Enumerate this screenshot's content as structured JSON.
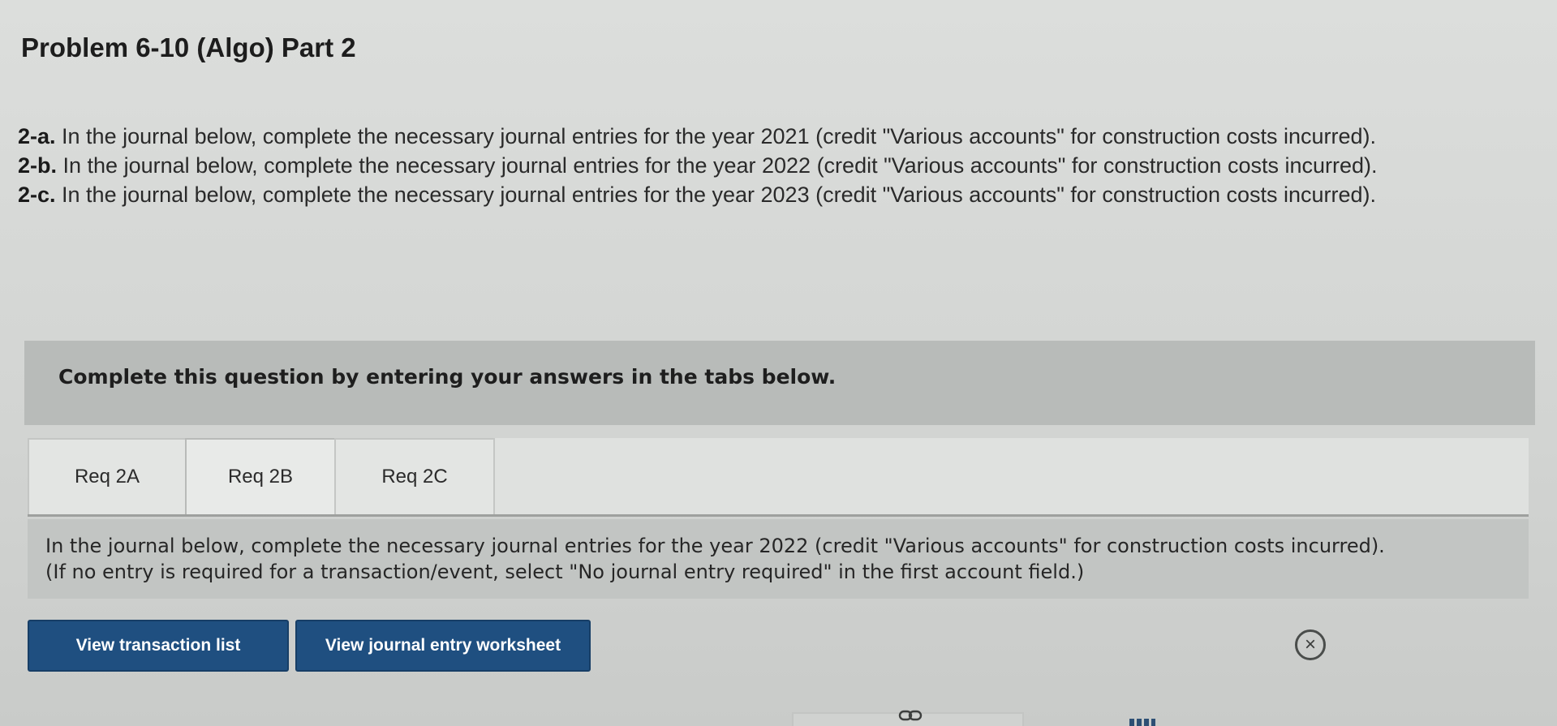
{
  "problem": {
    "title": "Problem 6-10 (Algo) Part 2"
  },
  "instructions": [
    {
      "label": "2-a.",
      "text": " In the journal below, complete the necessary journal entries for the year 2021 (credit \"Various accounts\" for construction costs incurred)."
    },
    {
      "label": "2-b.",
      "text": " In the journal below, complete the necessary journal entries for the year 2022 (credit \"Various accounts\" for construction costs incurred)."
    },
    {
      "label": "2-c.",
      "text": " In the journal below, complete the necessary journal entries for the year 2023 (credit \"Various accounts\" for construction costs incurred)."
    }
  ],
  "banner": {
    "text": "Complete this question by entering your answers in the tabs below."
  },
  "tabs": [
    {
      "label": "Req 2A",
      "active": false
    },
    {
      "label": "Req 2B",
      "active": true
    },
    {
      "label": "Req 2C",
      "active": false
    }
  ],
  "tab_content": {
    "line1": "In the journal below, complete the necessary journal entries for the year 2022 (credit \"Various accounts\" for construction costs incurred).",
    "line2": "(If no entry is required for a transaction/event, select \"No journal entry required\" in the first account field.)"
  },
  "buttons": {
    "view_transaction_list": "View transaction list",
    "view_journal_entry_worksheet": "View journal entry worksheet"
  },
  "icons": {
    "close": "close-icon",
    "link": "link-icon"
  },
  "colors": {
    "button_bg": "#1f4f80",
    "banner_bg": "#b8bbb9",
    "info_bg": "#c2c5c3"
  }
}
